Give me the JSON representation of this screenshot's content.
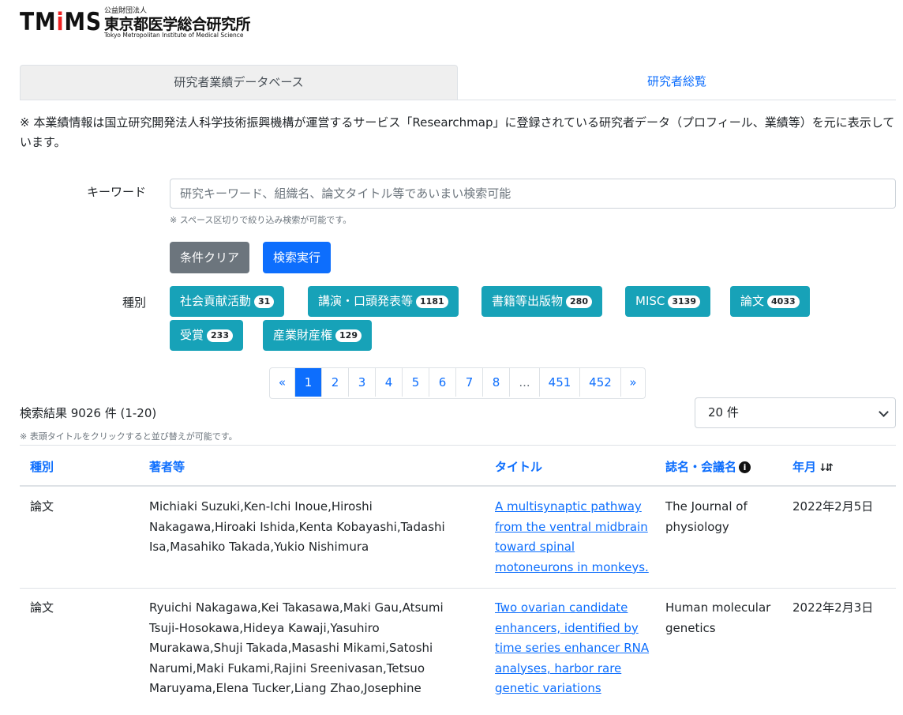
{
  "logo": {
    "mark": "TMiMS",
    "small": "公益財団法人",
    "org": "東京都医学総合研究所",
    "en": "Tokyo Metropolitan Institute of Medical Science"
  },
  "tabs": [
    {
      "label": "研究者業績データベース",
      "active": true
    },
    {
      "label": "研究者総覧",
      "active": false
    }
  ],
  "notice": "※ 本業績情報は国立研究開発法人科学技術振興機構が運営するサービス「Researchmap」に登録されている研究者データ（プロフィール、業績等）を元に表示しています。",
  "search": {
    "label": "キーワード",
    "placeholder": "研究キーワード、組織名、論文タイトル等であいまい検索可能",
    "hint": "※ スペース区切りで絞り込み検索が可能です。",
    "clear_label": "条件クリア",
    "submit_label": "検索実行"
  },
  "types": {
    "label": "種別",
    "chips": [
      {
        "label": "社会貢献活動",
        "count": "31"
      },
      {
        "label": "講演・口頭発表等",
        "count": "1181"
      },
      {
        "label": "書籍等出版物",
        "count": "280"
      },
      {
        "label": "MISC",
        "count": "3139"
      },
      {
        "label": "論文",
        "count": "4033"
      },
      {
        "label": "受賞",
        "count": "233"
      },
      {
        "label": "産業財産権",
        "count": "129"
      }
    ]
  },
  "pagination": {
    "prev": "«",
    "pages": [
      "1",
      "2",
      "3",
      "4",
      "5",
      "6",
      "7",
      "8"
    ],
    "ellipsis": "...",
    "last_pages": [
      "451",
      "452"
    ],
    "next": "»",
    "current": "1"
  },
  "results": {
    "count_text": "検索結果 9026 件 (1-20)",
    "sort_hint": "※ 表頭タイトルをクリックすると並び替えが可能です。",
    "per_page": "20 件"
  },
  "table": {
    "headers": {
      "type": "種別",
      "authors": "著者等",
      "title": "タイトル",
      "journal": "誌名・会議名",
      "date": "年月"
    },
    "rows": [
      {
        "type": "論文",
        "authors": "Michiaki Suzuki,Ken-Ichi Inoue,Hiroshi Nakagawa,Hiroaki Ishida,Kenta Kobayashi,Tadashi Isa,Masahiko Takada,Yukio Nishimura",
        "title": "A multisynaptic pathway from the ventral midbrain toward spinal motoneurons in monkeys.",
        "journal": "The Journal of physiology",
        "date": "2022年2月5日"
      },
      {
        "type": "論文",
        "authors": "Ryuichi Nakagawa,Kei Takasawa,Maki Gau,Atsumi Tsuji-Hosokawa,Hideya Kawaji,Yasuhiro Murakawa,Shuji Takada,Masashi Mikami,Satoshi Narumi,Maki Fukami,Rajini Sreenivasan,Tetsuo Maruyama,Elena Tucker,Liang Zhao,Josephine",
        "title": "Two ovarian candidate enhancers, identified by time series enhancer RNA analyses, harbor rare genetic variations",
        "journal": "Human molecular genetics",
        "date": "2022年2月3日"
      }
    ]
  },
  "colors": {
    "primary": "#0d6efd",
    "secondary": "#6c757d",
    "info": "#17a2b8",
    "tab_active_bg": "#efefef"
  }
}
